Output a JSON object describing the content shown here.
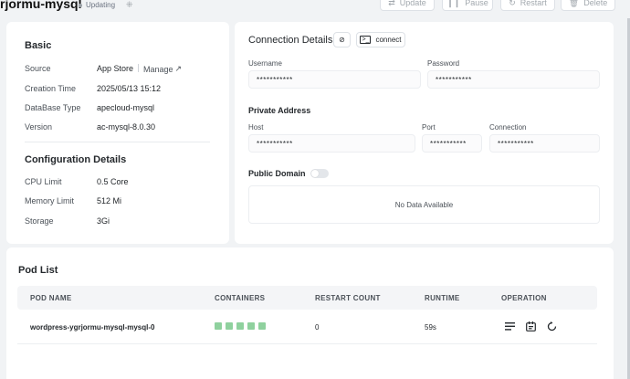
{
  "header": {
    "app_name": "rjormu-mysql",
    "status": "Updating",
    "actions": [
      {
        "label": "Update",
        "icon": "update-icon"
      },
      {
        "label": "Pause",
        "icon": "pause-icon"
      },
      {
        "label": "Restart",
        "icon": "restart-icon"
      },
      {
        "label": "Delete",
        "icon": "trash-icon"
      }
    ]
  },
  "basic": {
    "title": "Basic",
    "rows": [
      {
        "label": "Source",
        "value": "App Store",
        "link": "Manage"
      },
      {
        "label": "Creation Time",
        "value": "2025/05/13 15:12"
      },
      {
        "label": "DataBase Type",
        "value": "apecloud-mysql"
      },
      {
        "label": "Version",
        "value": "ac-mysql-8.0.30"
      }
    ]
  },
  "config": {
    "title": "Configuration Details",
    "rows": [
      {
        "label": "CPU Limit",
        "value": "0.5 Core"
      },
      {
        "label": "Memory Limit",
        "value": "512 Mi"
      },
      {
        "label": "Storage",
        "value": "3Gi"
      }
    ]
  },
  "connection": {
    "title": "Connection Details",
    "connect_label": "connect",
    "username_label": "Username",
    "username_value": "***********",
    "password_label": "Password",
    "password_value": "***********",
    "private_title": "Private Address",
    "host_label": "Host",
    "host_value": "***********",
    "port_label": "Port",
    "port_value": "***********",
    "connection_label": "Connection",
    "connection_value": "***********",
    "public_title": "Public Domain",
    "public_enabled": false,
    "empty_text": "No Data Available"
  },
  "pods": {
    "title": "Pod List",
    "columns": [
      "POD NAME",
      "CONTAINERS",
      "RESTART COUNT",
      "RUNTIME",
      "OPERATION"
    ],
    "rows": [
      {
        "name": "wordpress-ygrjormu-mysql-mysql-0",
        "containers": 5,
        "restart_count": "0",
        "runtime": "59s"
      }
    ]
  },
  "colors": {
    "container_ok": "#8fd19e",
    "background": "#f1f3f5"
  }
}
